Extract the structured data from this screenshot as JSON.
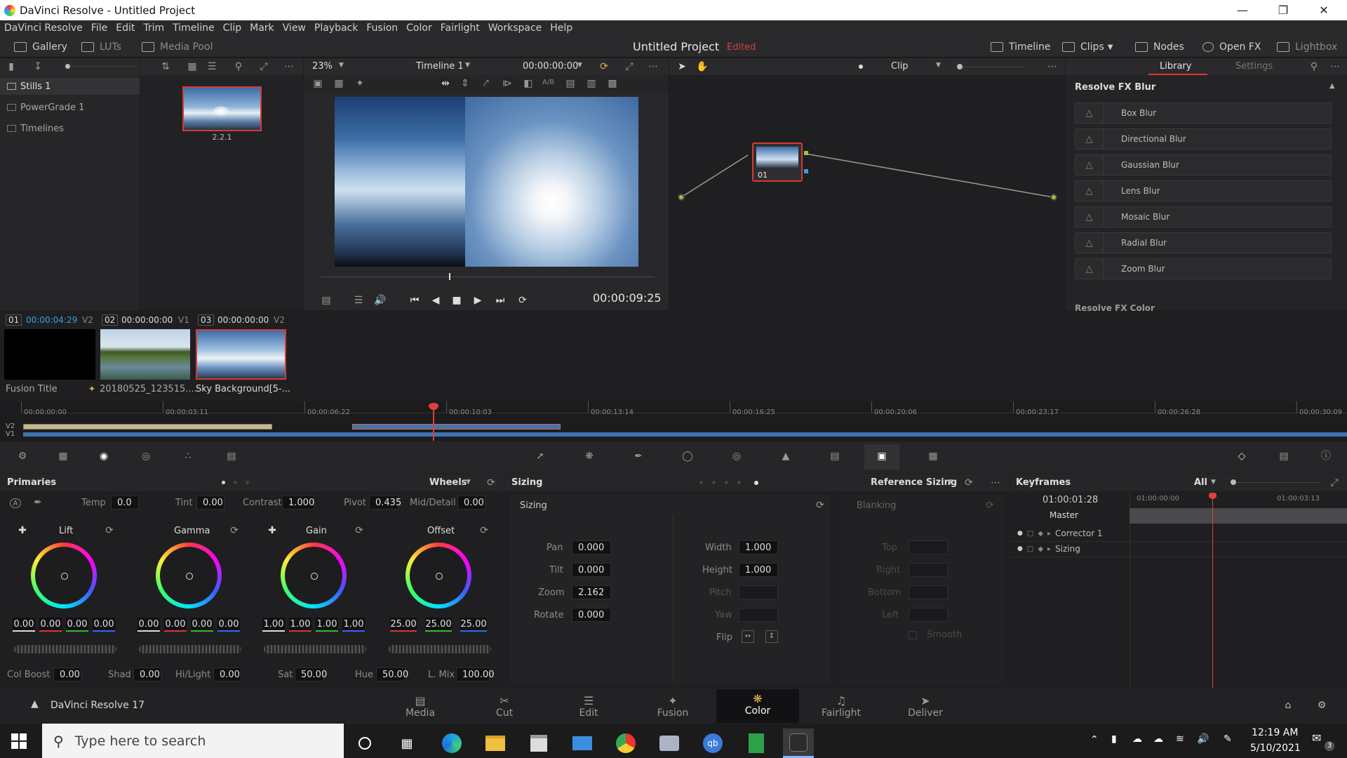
{
  "window": {
    "title": "DaVinci Resolve - Untitled Project"
  },
  "menu": [
    "DaVinci Resolve",
    "File",
    "Edit",
    "Trim",
    "Timeline",
    "Clip",
    "Mark",
    "View",
    "Playback",
    "Fusion",
    "Color",
    "Fairlight",
    "Workspace",
    "Help"
  ],
  "toolbar": {
    "gallery": "Gallery",
    "luts": "LUTs",
    "media_pool": "Media Pool",
    "project_title": "Untitled Project",
    "edited": "Edited",
    "timeline": "Timeline",
    "clips": "Clips",
    "nodes": "Nodes",
    "open_fx": "Open FX",
    "lightbox": "Lightbox"
  },
  "gallery": {
    "albums": [
      "Stills 1",
      "PowerGrade 1",
      "Timelines"
    ],
    "still_label": "2.2.1"
  },
  "viewer": {
    "zoom": "23%",
    "timeline_name": "Timeline 1",
    "timecode_top": "00:00:00:00",
    "timecode": "00:00:09:25",
    "ab": "A/B"
  },
  "nodes": {
    "mode": "Clip",
    "node_label": "01"
  },
  "library": {
    "tab_library": "Library",
    "tab_settings": "Settings",
    "section": "Resolve FX Blur",
    "items": [
      "Box Blur",
      "Directional Blur",
      "Gaussian Blur",
      "Lens Blur",
      "Mosaic Blur",
      "Radial Blur",
      "Zoom Blur"
    ],
    "next_section": "Resolve FX Color"
  },
  "clips": [
    {
      "num": "01",
      "tc": "00:00:04:29",
      "track": "V2",
      "name": "Fusion Title"
    },
    {
      "num": "02",
      "tc": "00:00:00:00",
      "track": "V1",
      "name": "20180525_123515...."
    },
    {
      "num": "03",
      "tc": "00:00:00:00",
      "track": "V2",
      "name": "Sky Background[5-..."
    }
  ],
  "ruler": [
    "00:00:00:00",
    "00:00:03:11",
    "00:00:06:22",
    "00:00:10:03",
    "00:00:13:14",
    "00:00:16:25",
    "00:00:20:06",
    "00:00:23:17",
    "00:00:26:28",
    "00:00:30:09"
  ],
  "tracks": [
    "V2",
    "V1"
  ],
  "primaries": {
    "title": "Primaries",
    "mode": "Wheels",
    "temp_label": "Temp",
    "temp": "0.0",
    "tint_label": "Tint",
    "tint": "0.00",
    "contrast_label": "Contrast",
    "contrast": "1.000",
    "pivot_label": "Pivot",
    "pivot": "0.435",
    "md_label": "Mid/Detail",
    "md": "0.00",
    "wheels": [
      {
        "name": "Lift",
        "vals": [
          "0.00",
          "0.00",
          "0.00",
          "0.00"
        ]
      },
      {
        "name": "Gamma",
        "vals": [
          "0.00",
          "0.00",
          "0.00",
          "0.00"
        ]
      },
      {
        "name": "Gain",
        "vals": [
          "1.00",
          "1.00",
          "1.00",
          "1.00"
        ]
      },
      {
        "name": "Offset",
        "vals": [
          "25.00",
          "25.00",
          "25.00"
        ]
      }
    ],
    "colboost_label": "Col Boost",
    "colboost": "0.00",
    "shad_label": "Shad",
    "shad": "0.00",
    "hilight_label": "Hi/Light",
    "hilight": "0.00",
    "sat_label": "Sat",
    "sat": "50.00",
    "hue_label": "Hue",
    "hue": "50.00",
    "lmix_label": "L. Mix",
    "lmix": "100.00"
  },
  "sizing": {
    "title": "Sizing",
    "mode": "Reference Sizing",
    "section": "Sizing",
    "pan_label": "Pan",
    "pan": "0.000",
    "tilt_label": "Tilt",
    "tilt": "0.000",
    "zoom_label": "Zoom",
    "zoom": "2.162",
    "rotate_label": "Rotate",
    "rotate": "0.000",
    "width_label": "Width",
    "width": "1.000",
    "height_label": "Height",
    "height": "1.000",
    "pitch_label": "Pitch",
    "yaw_label": "Yaw",
    "flip_label": "Flip",
    "blanking": "Blanking",
    "top": "Top",
    "right": "Right",
    "bottom": "Bottom",
    "left": "Left",
    "smooth": "Smooth"
  },
  "keyframes": {
    "title": "Keyframes",
    "filter": "All",
    "timecode": "01:00:01:28",
    "ruler": [
      "01:00:00:00",
      "01:00:03:13"
    ],
    "rows": [
      "Master",
      "Corrector 1",
      "Sizing"
    ]
  },
  "pages": {
    "app": "DaVinci Resolve 17",
    "items": [
      "Media",
      "Cut",
      "Edit",
      "Fusion",
      "Color",
      "Fairlight",
      "Deliver"
    ],
    "active": "Color"
  },
  "taskbar": {
    "search_placeholder": "Type here to search",
    "time": "12:19 AM",
    "date": "5/10/2021",
    "notif": "3"
  },
  "colors": {
    "accent_red": "#e0403a",
    "accent_orange": "#e88a3a",
    "bg": "#1e1e20"
  }
}
